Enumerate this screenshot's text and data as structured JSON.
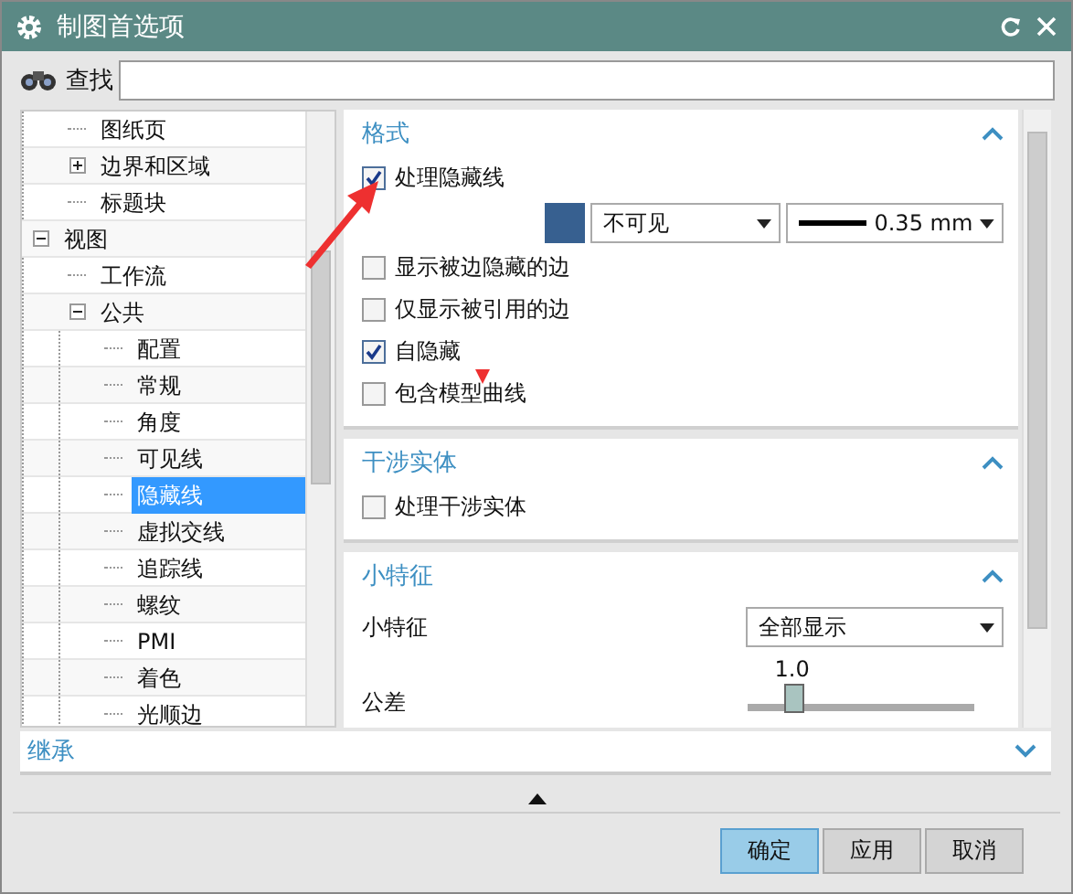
{
  "window": {
    "title": "制图首选项"
  },
  "search": {
    "label": "查找"
  },
  "tree": {
    "continued_items": [
      {
        "label": "图纸页",
        "selected": false
      },
      {
        "label": "边界和区域",
        "selected": false,
        "expanded": false
      },
      {
        "label": "标题块",
        "selected": false
      }
    ],
    "items": [
      {
        "label": "视图",
        "selected": false,
        "expanded": true,
        "children": [
          {
            "label": "工作流",
            "selected": false
          },
          {
            "label": "公共",
            "selected": false,
            "expanded": true,
            "children": [
              {
                "label": "配置",
                "selected": false
              },
              {
                "label": "常规",
                "selected": false
              },
              {
                "label": "角度",
                "selected": false
              },
              {
                "label": "可见线",
                "selected": false
              },
              {
                "label": "隐藏线",
                "selected": true
              },
              {
                "label": "虚拟交线",
                "selected": false
              },
              {
                "label": "追踪线",
                "selected": false
              },
              {
                "label": "螺纹",
                "selected": false
              },
              {
                "label": "PMI",
                "selected": false
              },
              {
                "label": "着色",
                "selected": false
              },
              {
                "label": "光顺边",
                "selected": false
              }
            ]
          }
        ]
      }
    ]
  },
  "sections": [
    {
      "title": "格式",
      "expanded": true,
      "rows": [
        {
          "kind": "checkbox",
          "label": "处理隐藏线",
          "checked": true
        },
        {
          "kind": "line_style",
          "color": "#376090",
          "style": "不可见",
          "width": "0.35 mm"
        },
        {
          "kind": "checkbox",
          "label": "显示被边隐藏的边",
          "checked": false
        },
        {
          "kind": "checkbox",
          "label": "仅显示被引用的边",
          "checked": false
        },
        {
          "kind": "checkbox",
          "label": "自隐藏",
          "checked": true
        },
        {
          "kind": "checkbox",
          "label": "包含模型曲线",
          "checked": false
        }
      ]
    },
    {
      "title": "干涉实体",
      "expanded": true,
      "rows": [
        {
          "kind": "checkbox",
          "label": "处理干涉实体",
          "checked": false
        }
      ]
    },
    {
      "title": "小特征",
      "expanded": true,
      "rows": [
        {
          "kind": "select",
          "label": "小特征",
          "value": "全部显示"
        },
        {
          "kind": "slider",
          "label": "公差",
          "reading": "1.0",
          "level": 0.2
        }
      ]
    }
  ],
  "footer_section": {
    "title": "继承",
    "expanded": false
  },
  "buttons": [
    {
      "label": "确定",
      "default": true
    },
    {
      "label": "应用",
      "default": false
    },
    {
      "label": "取消",
      "default": false
    }
  ]
}
